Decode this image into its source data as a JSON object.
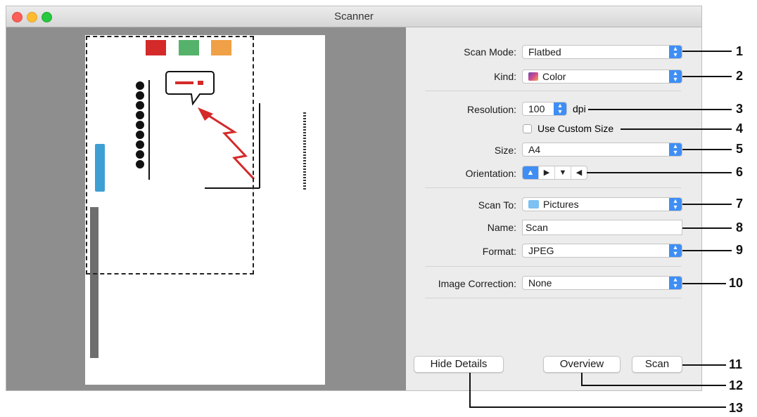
{
  "window": {
    "title": "Scanner"
  },
  "form": {
    "scan_mode": {
      "label": "Scan Mode:",
      "value": "Flatbed"
    },
    "kind": {
      "label": "Kind:",
      "value": "Color",
      "icon": "color-kind-icon"
    },
    "resolution": {
      "label": "Resolution:",
      "value": "100",
      "unit": "dpi"
    },
    "custom_size": {
      "label": "Use Custom Size",
      "checked": false
    },
    "size": {
      "label": "Size:",
      "value": "A4"
    },
    "orientation": {
      "label": "Orientation:",
      "options": [
        "portrait-upright",
        "landscape-left",
        "portrait-inverted",
        "landscape-right"
      ],
      "selected": 0
    },
    "scan_to": {
      "label": "Scan To:",
      "value": "Pictures",
      "icon": "folder-icon"
    },
    "name": {
      "label": "Name:",
      "value": "Scan"
    },
    "format": {
      "label": "Format:",
      "value": "JPEG"
    },
    "image_correction": {
      "label": "Image Correction:",
      "value": "None"
    }
  },
  "buttons": {
    "hide_details": "Hide Details",
    "overview": "Overview",
    "scan": "Scan"
  },
  "callouts": [
    "1",
    "2",
    "3",
    "4",
    "5",
    "6",
    "7",
    "8",
    "9",
    "10",
    "11",
    "12",
    "13"
  ],
  "colors": {
    "accent": "#3f8ef5",
    "preview_bg": "#8e8e8e",
    "panel_bg": "#ececec"
  }
}
